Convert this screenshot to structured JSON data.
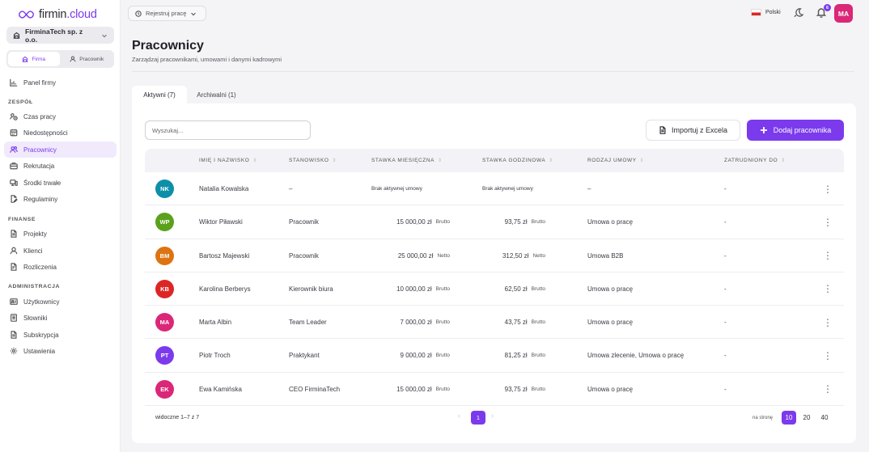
{
  "brand": {
    "name_part1": "firmin",
    "name_part2": ".cloud",
    "accent_color": "#7c3aed"
  },
  "sidebar": {
    "company": "FirminaTech sp. z o.o.",
    "context_tabs": [
      {
        "label": "Firma",
        "active": true
      },
      {
        "label": "Pracownik",
        "active": false
      }
    ],
    "top_item": "Panel firmy",
    "sections": [
      {
        "title": "ZESPÓŁ",
        "items": [
          "Czas pracy",
          "Niedostępności",
          "Pracownicy",
          "Rekrutacja",
          "Środki trwałe",
          "Regulaminy"
        ]
      },
      {
        "title": "FINANSE",
        "items": [
          "Projekty",
          "Klienci",
          "Rozliczenia"
        ]
      },
      {
        "title": "ADMINISTRACJA",
        "items": [
          "Użytkownicy",
          "Słowniki",
          "Subskrypcja",
          "Ustawienia"
        ]
      }
    ],
    "active_item": "Pracownicy"
  },
  "topbar": {
    "register_button": "Rejestruj pracę",
    "language": "Polski",
    "notification_count": "6",
    "user_initials": "MA",
    "user_color": "#db2777"
  },
  "header": {
    "title": "Pracownicy",
    "subtitle": "Zarządzaj pracownikami, umowami i danymi kadrowymi"
  },
  "tabs": [
    {
      "label": "Aktywni (7)",
      "active": true
    },
    {
      "label": "Archiwalni (1)",
      "active": false
    }
  ],
  "toolbar": {
    "search_placeholder": "Wyszukaj...",
    "import_label": "Importuj z Excela",
    "add_label": "Dodaj pracownika"
  },
  "table": {
    "columns": [
      "IMIĘ I NAZWISKO",
      "STANOWISKO",
      "STAWKA MIESIĘCZNA",
      "STAWKA GODZINOWA",
      "RODZAJ UMOWY",
      "ZATRUDNIONY DO"
    ],
    "rows": [
      {
        "initials": "NK",
        "color": "#0e8fa8",
        "name": "Natalia Kowalska",
        "position": "–",
        "monthly": "Brak aktywnej umowy",
        "monthly_type": "",
        "hourly": "Brak aktywnej umowy",
        "hourly_type": "",
        "contract": "–",
        "until": "-",
        "no_contract": true
      },
      {
        "initials": "WP",
        "color": "#5aa11c",
        "name": "Wiktor Piławski",
        "position": "Pracownik",
        "monthly": "15 000,00 zł",
        "monthly_type": "Brutto",
        "hourly": "93,75 zł",
        "hourly_type": "Brutto",
        "contract": "Umowa o pracę",
        "until": "-"
      },
      {
        "initials": "BM",
        "color": "#dd7412",
        "name": "Bartosz Majewski",
        "position": "Pracownik",
        "monthly": "25 000,00 zł",
        "monthly_type": "Netto",
        "hourly": "312,50 zł",
        "hourly_type": "Netto",
        "contract": "Umowa B2B",
        "until": "-"
      },
      {
        "initials": "KB",
        "color": "#dc2626",
        "name": "Karolina Berberys",
        "position": "Kierownik biura",
        "monthly": "10 000,00 zł",
        "monthly_type": "Brutto",
        "hourly": "62,50 zł",
        "hourly_type": "Brutto",
        "contract": "Umowa o pracę",
        "until": "-"
      },
      {
        "initials": "MA",
        "color": "#db2777",
        "name": "Marta Albin",
        "position": "Team Leader",
        "monthly": "7 000,00 zł",
        "monthly_type": "Brutto",
        "hourly": "43,75 zł",
        "hourly_type": "Brutto",
        "contract": "Umowa o pracę",
        "until": "-"
      },
      {
        "initials": "PT",
        "color": "#7c3aed",
        "name": "Piotr Troch",
        "position": "Praktykant",
        "monthly": "9 000,00 zł",
        "monthly_type": "Brutto",
        "hourly": "81,25 zł",
        "hourly_type": "Brutto",
        "contract": "Umowa zlecenie, Umowa o pracę",
        "until": "-"
      },
      {
        "initials": "EK",
        "color": "#db2777",
        "name": "Ewa Kamińska",
        "position": "CEO FirminaTech",
        "monthly": "15 000,00 zł",
        "monthly_type": "Brutto",
        "hourly": "93,75 zł",
        "hourly_type": "Brutto",
        "contract": "Umowa o pracę",
        "until": "-"
      }
    ]
  },
  "footer": {
    "visible_text": "widoczne 1–7 z 7",
    "current_page": "1",
    "per_page_label": "na stronę",
    "per_page_options": [
      "10",
      "20",
      "40"
    ],
    "per_page_selected": "10"
  }
}
